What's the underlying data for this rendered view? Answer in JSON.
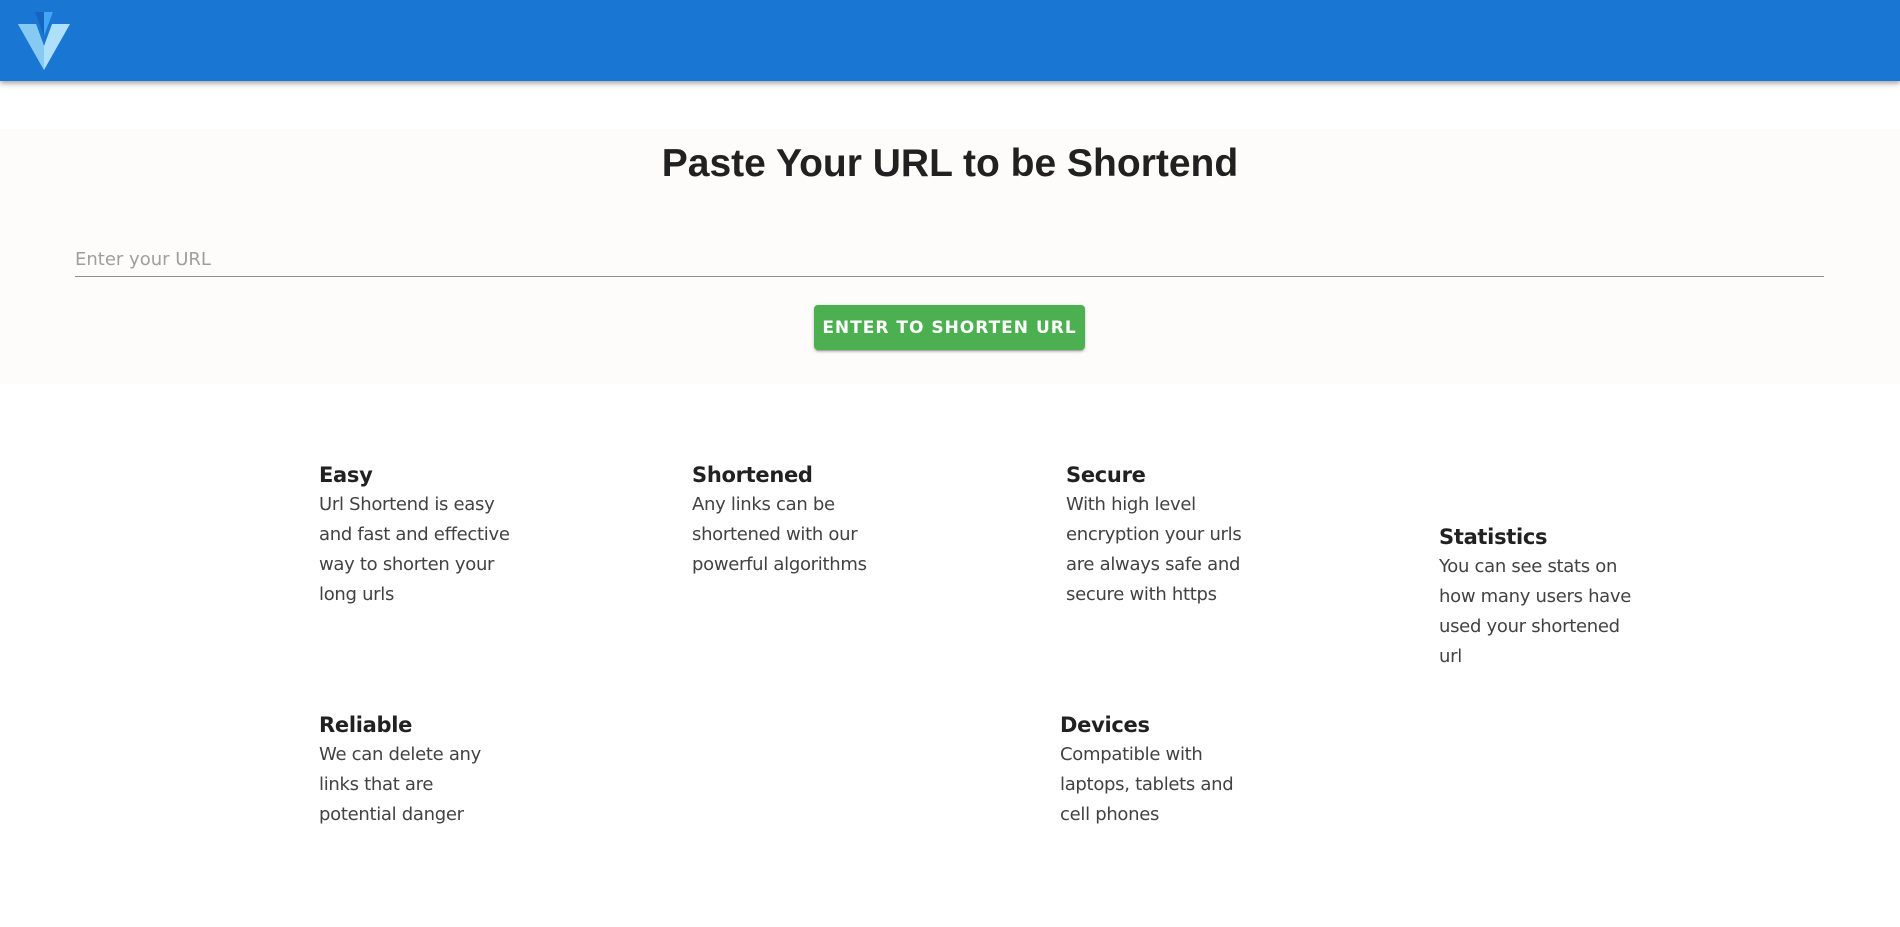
{
  "header": {
    "logo_icon": "vuetify-logo-icon",
    "background_color": "#1976d2"
  },
  "hero": {
    "title": "Paste Your URL to be Shortend",
    "input": {
      "placeholder": "Enter your URL",
      "value": ""
    },
    "button_label": "Enter to shorten URL",
    "button_color": "#4caf50"
  },
  "features": {
    "easy": {
      "title": "Easy",
      "text": "Url Shortend is easy and fast and effective way to shorten your long urls"
    },
    "shortened": {
      "title": "Shortened",
      "text": "Any links can be shortened with our powerful algorithms"
    },
    "secure": {
      "title": "Secure",
      "text": "With high level encryption your urls are always safe and secure with https"
    },
    "statistics": {
      "title": "Statistics",
      "text": "You can see stats on how many users have used your shortened url"
    },
    "reliable": {
      "title": "Reliable",
      "text": "We can delete any links that are potential danger"
    },
    "devices": {
      "title": "Devices",
      "text": "Compatible with laptops, tablets and cell phones"
    }
  }
}
